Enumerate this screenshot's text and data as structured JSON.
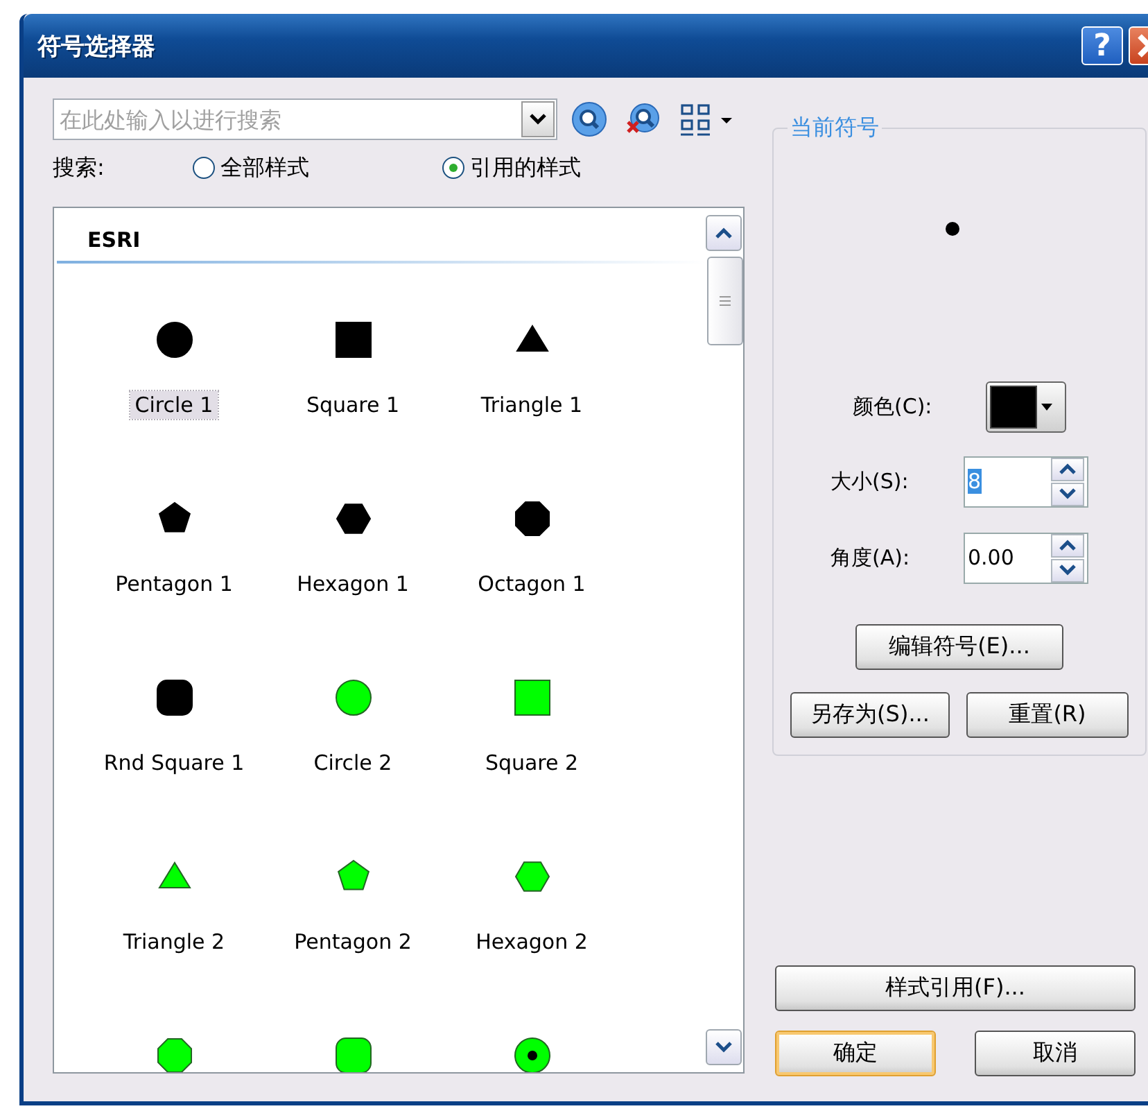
{
  "window": {
    "title": "符号选择器",
    "help_button": "?"
  },
  "search": {
    "placeholder": "在此处输入以进行搜索"
  },
  "search_scope": {
    "label": "搜索:",
    "options": [
      {
        "label": "全部样式",
        "selected": false
      },
      {
        "label": "引用的样式",
        "selected": true
      }
    ]
  },
  "symbol_list": {
    "group": "ESRI",
    "items": [
      {
        "name": "Circle 1",
        "kind": "circle",
        "color": "#000000",
        "selected": true
      },
      {
        "name": "Square 1",
        "kind": "square",
        "color": "#000000",
        "selected": false
      },
      {
        "name": "Triangle 1",
        "kind": "triangle",
        "color": "#000000",
        "selected": false
      },
      {
        "name": "Pentagon 1",
        "kind": "pentagon",
        "color": "#000000",
        "selected": false
      },
      {
        "name": "Hexagon 1",
        "kind": "hexagon",
        "color": "#000000",
        "selected": false
      },
      {
        "name": "Octagon 1",
        "kind": "octagon",
        "color": "#000000",
        "selected": false
      },
      {
        "name": "Rnd Square 1",
        "kind": "roundsquare",
        "color": "#000000",
        "selected": false
      },
      {
        "name": "Circle 2",
        "kind": "circle",
        "color": "#00ff00",
        "selected": false
      },
      {
        "name": "Square 2",
        "kind": "square",
        "color": "#00ff00",
        "selected": false
      },
      {
        "name": "Triangle 2",
        "kind": "triangle",
        "color": "#00ff00",
        "selected": false
      },
      {
        "name": "Pentagon 2",
        "kind": "pentagon",
        "color": "#00ff00",
        "selected": false
      },
      {
        "name": "Hexagon 2",
        "kind": "hexagon",
        "color": "#00ff00",
        "selected": false
      },
      {
        "kind": "octagon",
        "color": "#00ff00"
      },
      {
        "kind": "roundsquare",
        "color": "#00ff00"
      },
      {
        "kind": "dotcircle",
        "color": "#00ff00"
      }
    ]
  },
  "current_symbol": {
    "legend": "当前符号",
    "color_label": "颜色(C):",
    "color": "#000000",
    "size_label": "大小(S):",
    "size": "8",
    "angle_label": "角度(A):",
    "angle": "0.00",
    "edit_button": "编辑符号(E)...",
    "save_as_button": "另存为(S)...",
    "reset_button": "重置(R)"
  },
  "style_references_button": "样式引用(F)...",
  "buttons": [
    {
      "label": "确定",
      "default": true
    },
    {
      "label": "取消",
      "default": false
    }
  ]
}
